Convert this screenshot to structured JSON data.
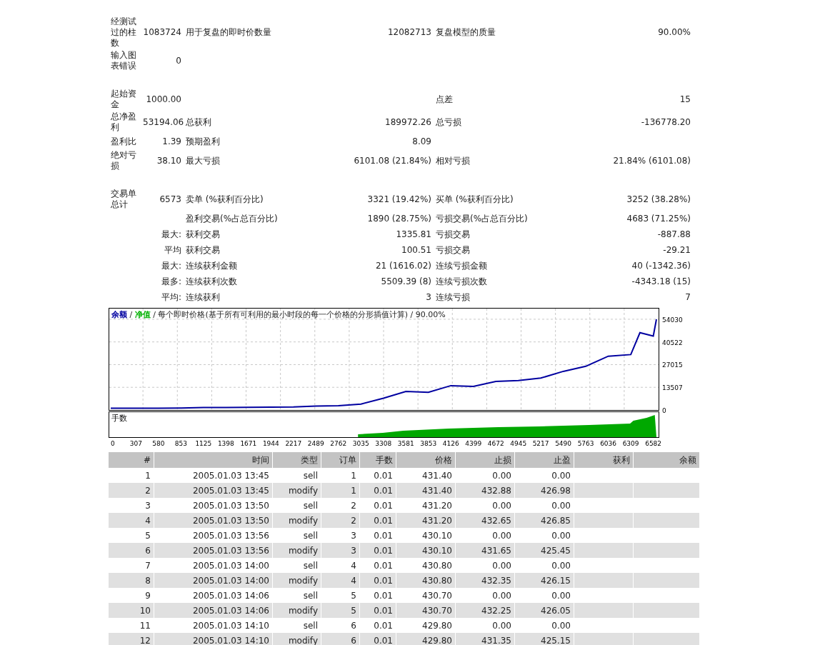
{
  "summary_groups": [
    {
      "rows": [
        {
          "l1": "经测试过的柱数",
          "v1": "1083724",
          "l2": "用于复盘的即时价数量",
          "v2": "12082713",
          "l3": "复盘模型的质量",
          "v3": "90.00%"
        },
        {
          "l1": "输入图表错误",
          "v1": "0"
        }
      ]
    },
    {
      "rows": [
        {
          "l1": "起始资金",
          "v1": "1000.00",
          "l3": "点差",
          "v3": "15"
        },
        {
          "l1": "总净盈利",
          "v1": "53194.06",
          "l2": "总获利",
          "v2": "189972.26",
          "l3": "总亏损",
          "v3": "-136778.20"
        },
        {
          "l1": "盈利比",
          "v1": "1.39",
          "l2": "预期盈利",
          "v2": "8.09"
        },
        {
          "l1": "绝对亏损",
          "v1": "38.10",
          "l2": "最大亏损",
          "v2": "6101.08 (21.84%)",
          "l3": "相对亏损",
          "v3": "21.84% (6101.08)"
        }
      ]
    },
    {
      "rows": [
        {
          "l1": "交易单总计",
          "v1": "6573",
          "l2": "卖单 (%获利百分比)",
          "v2": "3321 (19.42%)",
          "l3": "买单 (%获利百分比)",
          "v3": "3252 (38.28%)"
        },
        {
          "l2": "盈利交易(%占总百分比)",
          "v2": "1890 (28.75%)",
          "l3": "亏损交易(%占总百分比)",
          "v3": "4683 (71.25%)"
        },
        {
          "v1": "最大:",
          "l2": "获利交易",
          "v2": "1335.81",
          "l3": "亏损交易",
          "v3": "-887.88"
        },
        {
          "v1": "平均",
          "l2": "获利交易",
          "v2": "100.51",
          "l3": "亏损交易",
          "v3": "-29.21"
        },
        {
          "v1": "最大:",
          "l2": "连续获利金额",
          "v2": "21 (1616.02)",
          "l3": "连续亏损金额",
          "v3": "40 (-1342.36)"
        },
        {
          "v1": "最多:",
          "l2": "连续获利次数",
          "v2": "5509.39 (8)",
          "l3": "连续亏损次数",
          "v3": "-4343.18 (15)"
        },
        {
          "v1": "平均:",
          "l2": "连续获利",
          "v2": "3",
          "l3": "连续亏损",
          "v3": "7"
        }
      ]
    }
  ],
  "chart": {
    "equity_legend": {
      "text": "净值",
      "color": "#00b000"
    },
    "legend_separators": [
      "/",
      "/ 每个即时价格(基于所有可利用的最小时段的每一个价格的分形插值计算) / 90.00%"
    ],
    "lots_label": "手数",
    "chart_data": {
      "type": "line",
      "grid": true,
      "xlim": [
        0,
        6620
      ],
      "ylim": [
        0,
        60800
      ],
      "x": [
        0,
        307,
        580,
        853,
        1125,
        1398,
        1671,
        1944,
        2217,
        2489,
        2762,
        3035,
        3308,
        3581,
        3853,
        4126,
        4399,
        4672,
        4945,
        5217,
        5490,
        5763,
        6036,
        6309,
        6420,
        6582,
        6620
      ],
      "series": [
        {
          "name": "余额",
          "color": "#0000a0",
          "values": [
            1000,
            1000,
            1100,
            1200,
            1500,
            1500,
            1600,
            1700,
            1800,
            2300,
            2600,
            3500,
            7000,
            11000,
            10500,
            14500,
            14000,
            17000,
            17500,
            19000,
            23000,
            26000,
            32000,
            33000,
            46000,
            44000,
            54000
          ]
        }
      ],
      "yticks": [
        0,
        13507,
        27015,
        40522,
        54030
      ],
      "xticks": [
        0,
        307,
        580,
        853,
        1125,
        1398,
        1671,
        1944,
        2217,
        2489,
        2762,
        3035,
        3308,
        3581,
        3853,
        4126,
        4399,
        4672,
        4945,
        5217,
        5490,
        5763,
        6036,
        6309,
        6582
      ]
    }
  },
  "trades": {
    "columns": [
      "#",
      "时间",
      "类型",
      "订单",
      "手数",
      "价格",
      "止损",
      "止盈",
      "获利",
      "余额"
    ],
    "rows": [
      [
        "1",
        "2005.01.03 13:45",
        "sell",
        "1",
        "0.01",
        "431.40",
        "0.00",
        "0.00"
      ],
      [
        "2",
        "2005.01.03 13:45",
        "modify",
        "1",
        "0.01",
        "431.40",
        "432.88",
        "426.98"
      ],
      [
        "3",
        "2005.01.03 13:50",
        "sell",
        "2",
        "0.01",
        "431.20",
        "0.00",
        "0.00"
      ],
      [
        "4",
        "2005.01.03 13:50",
        "modify",
        "2",
        "0.01",
        "431.20",
        "432.65",
        "426.85"
      ],
      [
        "5",
        "2005.01.03 13:56",
        "sell",
        "3",
        "0.01",
        "430.10",
        "0.00",
        "0.00"
      ],
      [
        "6",
        "2005.01.03 13:56",
        "modify",
        "3",
        "0.01",
        "430.10",
        "431.65",
        "425.45"
      ],
      [
        "7",
        "2005.01.03 14:00",
        "sell",
        "4",
        "0.01",
        "430.80",
        "0.00",
        "0.00"
      ],
      [
        "8",
        "2005.01.03 14:00",
        "modify",
        "4",
        "0.01",
        "430.80",
        "432.35",
        "426.15"
      ],
      [
        "9",
        "2005.01.03 14:06",
        "sell",
        "5",
        "0.01",
        "430.70",
        "0.00",
        "0.00"
      ],
      [
        "10",
        "2005.01.03 14:06",
        "modify",
        "5",
        "0.01",
        "430.70",
        "432.25",
        "426.05"
      ],
      [
        "11",
        "2005.01.03 14:10",
        "sell",
        "6",
        "0.01",
        "429.80",
        "0.00",
        "0.00"
      ],
      [
        "12",
        "2005.01.03 14:10",
        "modify",
        "6",
        "0.01",
        "429.80",
        "431.35",
        "425.15"
      ]
    ]
  }
}
